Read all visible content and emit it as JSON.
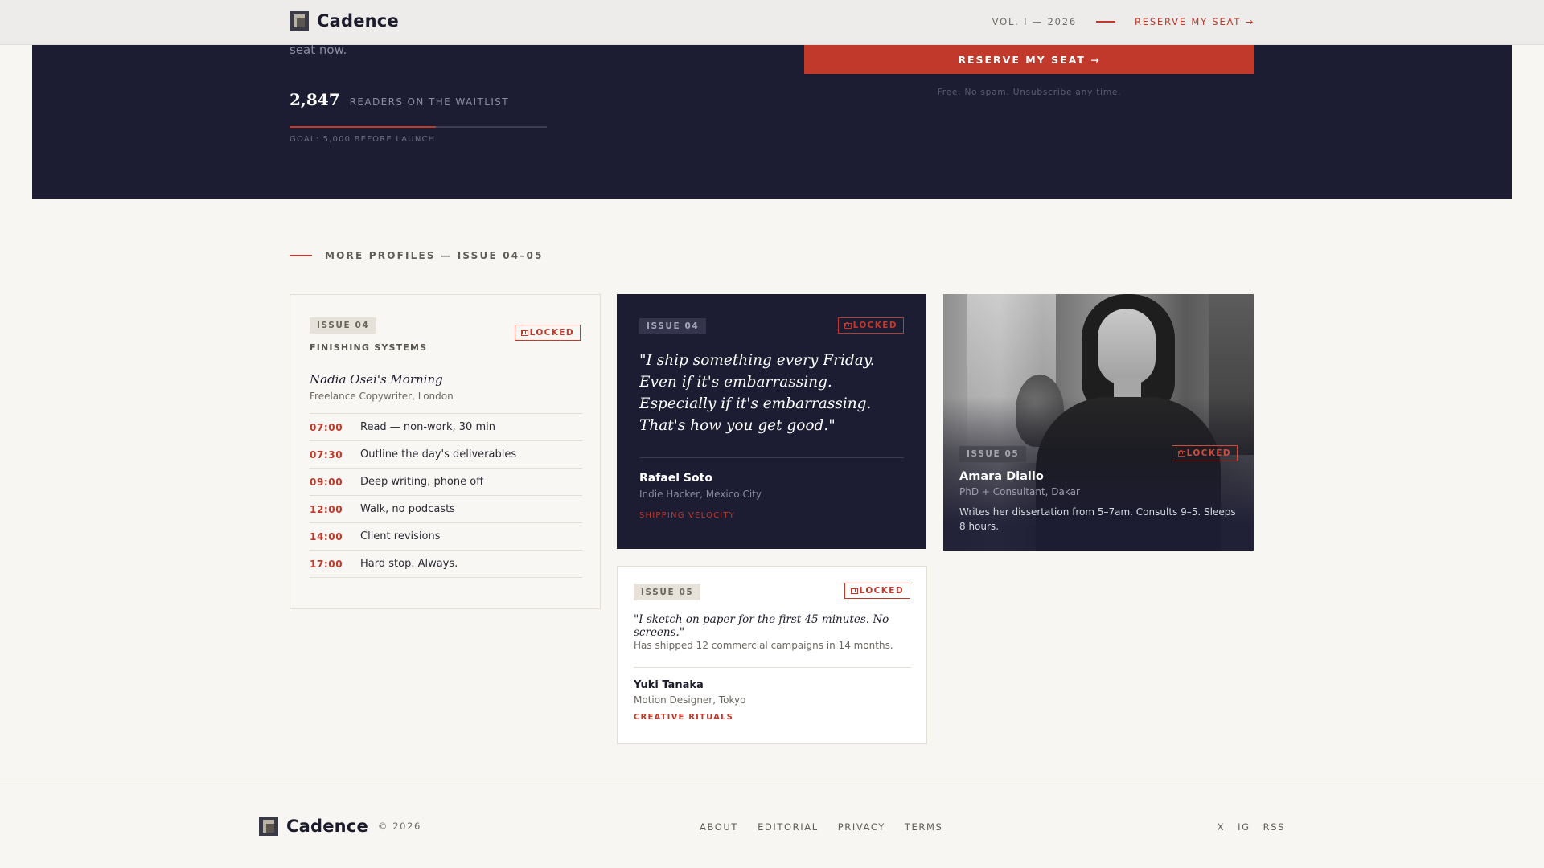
{
  "header": {
    "brand": "Cadence",
    "volume": "VOL. I — 2026",
    "reserve_link": "RESERVE MY SEAT →"
  },
  "hero": {
    "trailing_text": "seat now.",
    "waitlist_count": "2,847",
    "waitlist_label": "READERS ON THE WAITLIST",
    "waitlist_progress_percent": 57,
    "goal": "GOAL: 5,000 BEFORE LAUNCH",
    "cta_button": "RESERVE MY SEAT →",
    "cta_note": "Free. No spam. Unsubscribe any time."
  },
  "section": {
    "title": "MORE PROFILES — ISSUE 04–05"
  },
  "cards": {
    "nadia": {
      "issue": "ISSUE 04",
      "locked": "LOCKED",
      "theme": "FINISHING SYSTEMS",
      "title": "Nadia Osei's Morning",
      "subtitle": "Freelance Copywriter, London",
      "schedule": [
        {
          "time": "07:00",
          "task": "Read — non-work, 30 min"
        },
        {
          "time": "07:30",
          "task": "Outline the day's deliverables"
        },
        {
          "time": "09:00",
          "task": "Deep writing, phone off"
        },
        {
          "time": "12:00",
          "task": "Walk, no podcasts"
        },
        {
          "time": "14:00",
          "task": "Client revisions"
        },
        {
          "time": "17:00",
          "task": "Hard stop. Always."
        }
      ]
    },
    "rafael": {
      "issue": "ISSUE 04",
      "locked": "LOCKED",
      "quote": "\"I ship something every Friday. Even if it's embarrassing. Especially if it's embarrassing. That's how you get good.\"",
      "name": "Rafael Soto",
      "role": "Indie Hacker, Mexico City",
      "tag": "SHIPPING VELOCITY"
    },
    "amara": {
      "issue": "ISSUE 05",
      "locked": "LOCKED",
      "name": "Amara Diallo",
      "role": "PhD + Consultant, Dakar",
      "description": "Writes her dissertation from 5–7am. Consults 9–5. Sleeps 8 hours."
    },
    "yuki": {
      "issue": "ISSUE 05",
      "locked": "LOCKED",
      "quote": "\"I sketch on paper for the first 45 minutes. No screens.\"",
      "description": "Has shipped 12 commercial campaigns in 14 months.",
      "name": "Yuki Tanaka",
      "role": "Motion Designer, Tokyo",
      "tag": "CREATIVE RITUALS"
    }
  },
  "footer": {
    "brand": "Cadence",
    "copyright": "© 2026",
    "nav": [
      "ABOUT",
      "EDITORIAL",
      "PRIVACY",
      "TERMS"
    ],
    "social": [
      "X",
      "IG",
      "RSS"
    ]
  },
  "colors": {
    "accent": "#c0392b",
    "navy": "#1c1c33",
    "background": "#f8f6f2"
  }
}
